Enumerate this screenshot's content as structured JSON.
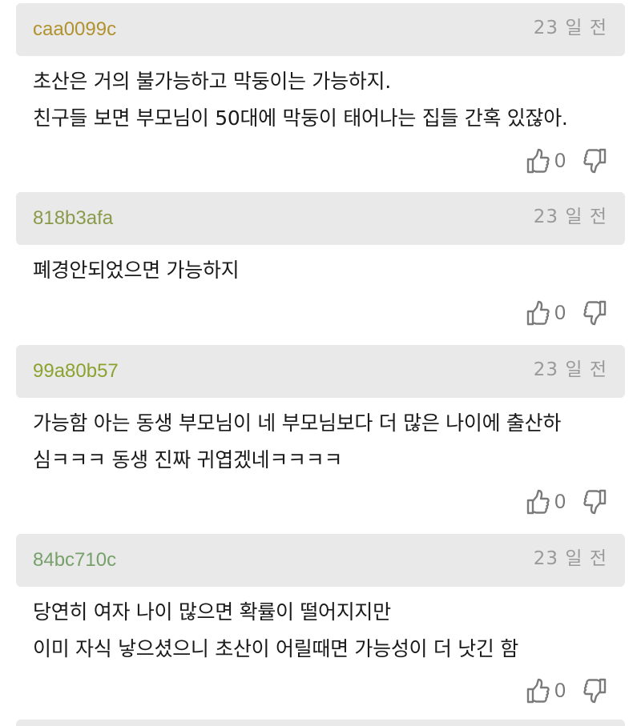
{
  "comments": [
    {
      "author": "caa0099c",
      "author_color": "#b1922f",
      "date": "23 일 전",
      "lines": [
        "초산은 거의 불가능하고 막둥이는 가능하지.",
        "친구들 보면 부모님이 50대에 막둥이 태어나는 집들 간혹 있잖아."
      ],
      "likes": "0"
    },
    {
      "author": "818b3afa",
      "author_color": "#8a9a4a",
      "date": "23 일 전",
      "lines": [
        "폐경안되었으면 가능하지"
      ],
      "likes": "0"
    },
    {
      "author": "99a80b57",
      "author_color": "#8ba22f",
      "date": "23 일 전",
      "lines": [
        "가능함 아는 동생 부모님이 네 부모님보다 더 많은 나이에 출산하",
        "심ㅋㅋㅋ 동생 진짜 귀엽겠네ㅋㅋㅋㅋ"
      ],
      "likes": "0"
    },
    {
      "author": "84bc710c",
      "author_color": "#77a06a",
      "date": "23 일 전",
      "lines": [
        "당연히 여자 나이 많으면 확률이 떨어지지만",
        "이미 자식 낳으셨으니 초산이 어릴때면 가능성이 더 낫긴 함"
      ],
      "likes": "0"
    }
  ],
  "icons": {
    "like": "thumbs-up-icon",
    "dislike": "thumbs-down-icon"
  }
}
